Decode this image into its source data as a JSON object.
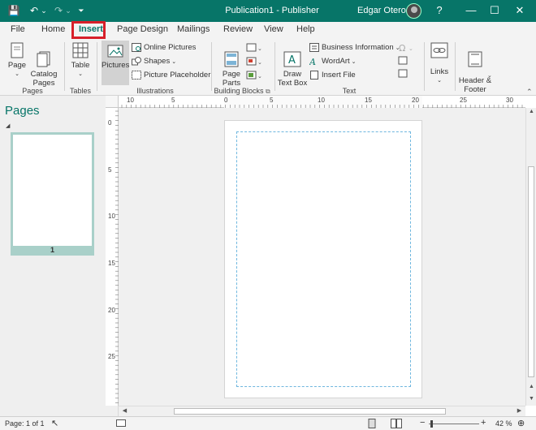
{
  "titlebar": {
    "title": "Publication1  -  Publisher",
    "user": "Edgar Otero",
    "help": "?",
    "minimize": "—",
    "maximize": "☐",
    "close": "✕",
    "qa_save": "💾",
    "qa_undo": "↶",
    "qa_undo_arrow": "⌄",
    "qa_redo": "↷",
    "qa_redo_arrow": "⌄",
    "qa_customize": "⏷"
  },
  "tabs": [
    "File",
    "Home",
    "Insert",
    "Page Design",
    "Mailings",
    "Review",
    "View",
    "Help"
  ],
  "ribbon": {
    "page": "Page",
    "catalog_pages": "Catalog\nPages",
    "group_pages": "Pages",
    "table": "Table",
    "group_tables": "Tables",
    "pictures": "Pictures",
    "online_pictures": "Online Pictures",
    "shapes": "Shapes",
    "picture_placeholder": "Picture Placeholder",
    "group_illustrations": "Illustrations",
    "page_parts": "Page\nParts",
    "group_building_blocks": "Building Blocks",
    "draw_text_box": "Draw\nText Box",
    "business_information": "Business Information",
    "wordart": "WordArt",
    "insert_file": "Insert File",
    "group_text": "Text",
    "links": "Links",
    "header_footer": "Header &\nFooter"
  },
  "pane": {
    "title": "Pages",
    "page_number": "1"
  },
  "hruler": [
    "10",
    "5",
    "0",
    "5",
    "10",
    "15",
    "20",
    "25",
    "30"
  ],
  "vruler": [
    "0",
    "5",
    "10",
    "15",
    "20",
    "25"
  ],
  "status": {
    "page": "Page: 1 of 1",
    "zoom": "42 %",
    "minus": "−",
    "plus": "+"
  },
  "colors": {
    "accent": "#077568",
    "highlight": "#d7202a",
    "guide": "#6fb7df"
  }
}
